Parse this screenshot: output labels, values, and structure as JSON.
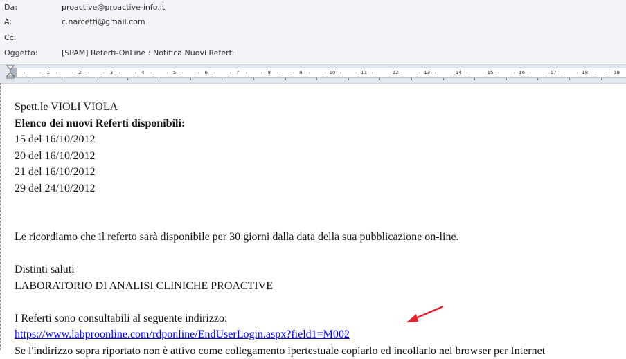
{
  "header": {
    "from": {
      "label": "Da:",
      "value": "proactive@proactive-info.it"
    },
    "to": {
      "label": "A:",
      "value": "c.narcetti@gmail.com"
    },
    "cc": {
      "label": "Cc:",
      "value": ""
    },
    "subject": {
      "label": "Oggetto:",
      "value": "[SPAM] Referti-OnLine : Notifica Nuovi Referti"
    }
  },
  "ruler": {
    "numbers": [
      "1",
      "2",
      "3",
      "4",
      "5",
      "6",
      "7",
      "8",
      "9",
      "10",
      "11",
      "12",
      "13",
      "14",
      "15",
      "16",
      "17",
      "18",
      "19"
    ]
  },
  "message": {
    "greeting": "Spett.le VIOLI VIOLA",
    "list_title": "Elenco dei nuovi Referti disponibili:",
    "reports": [
      "15 del 16/10/2012",
      "20 del 16/10/2012",
      "21 del 16/10/2012",
      "29 del 24/10/2012"
    ],
    "notice": "Le ricordiamo che il referto sarà disponibile per 30 giorni dalla data della sua pubblicazione on-line.",
    "closing": "Distinti saluti",
    "signature": "LABORATORIO DI ANALISI CLINICHE PROACTIVE",
    "link_intro": "I Referti sono consultabili al seguente indirizzo:",
    "link": "https://www.labproonline.com/rdponline/EndUserLogin.aspx?field1=M002",
    "footer": "Se l'indirizzo sopra riportato non è attivo come collegamento ipertestuale copiarlo ed incollarlo nel browser per Internet"
  },
  "colors": {
    "header_bg": "#f3f5f9",
    "ruler_bg": "#dfe6ef",
    "link": "#0000ee",
    "arrow": "#e8202a"
  },
  "icons": {
    "arrow": "red-arrow-icon",
    "indent": "indent-marker-icon"
  }
}
